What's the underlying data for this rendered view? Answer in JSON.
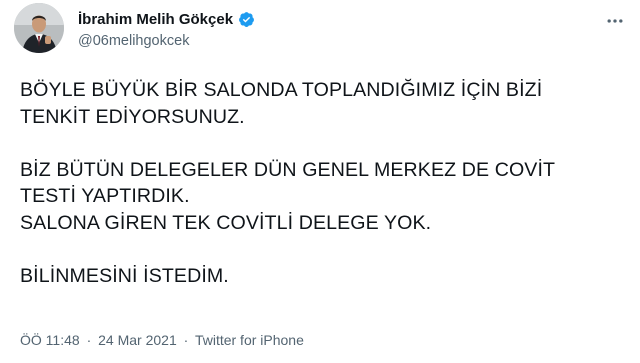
{
  "author": {
    "display_name": "İbrahim Melih Gökçek",
    "handle": "@06melihgokcek",
    "verified": true,
    "verified_color": "#1d9bf0"
  },
  "tweet": {
    "paragraphs": [
      [
        "BÖYLE BÜYÜK BİR SALONDA TOPLANDIĞIMIZ İÇİN BİZİ",
        "TENKİT EDİYORSUNUZ."
      ],
      [
        "BİZ BÜTÜN DELEGELER DÜN GENEL MERKEZ DE COVİT",
        "TESTİ YAPTIRDIK.",
        "SALONA GİREN TEK COVİTLİ DELEGE YOK."
      ],
      [
        "BİLİNMESİNİ İSTEDİM."
      ]
    ]
  },
  "meta": {
    "time": "ÖÖ 11:48",
    "separator": "·",
    "date": "24 Mar 2021",
    "source": "Twitter for iPhone"
  },
  "icons": {
    "more": "more-horizontal-icon",
    "verified": "verified-badge-icon"
  },
  "colors": {
    "text": "#0f1419",
    "secondary": "#536471"
  }
}
